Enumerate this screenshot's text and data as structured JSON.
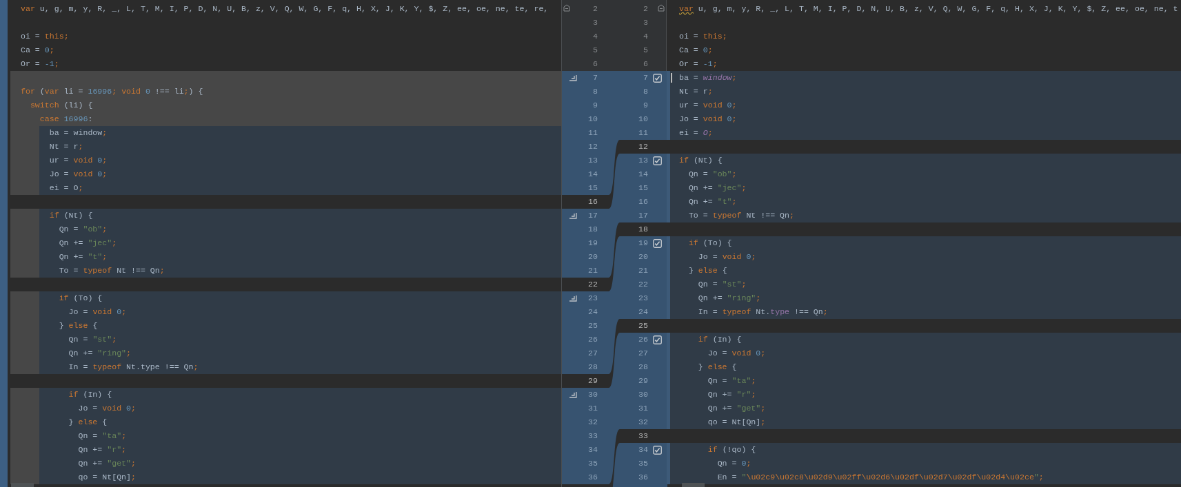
{
  "left_pane": {
    "lines": [
      {
        "num": "2",
        "kind": "context",
        "fold_marker": true,
        "tokens": [
          {
            "kind": "keyword",
            "text": "var"
          },
          {
            "kind": "plain",
            "text": " u, g, m, y, R, _, L, T, M, I, P, D, N, U, B, z, V, Q, W, G, F, q, H, X, J, K, Y, $, Z, ee, oe, ne, te, re,"
          }
        ]
      },
      {
        "num": "3",
        "kind": "context"
      },
      {
        "num": "4",
        "kind": "context",
        "tokens": [
          {
            "kind": "plain",
            "text": "oi = "
          },
          {
            "kind": "keyword",
            "text": "this;"
          }
        ]
      },
      {
        "num": "5",
        "kind": "context",
        "tokens": [
          {
            "kind": "plain",
            "text": "Ca = "
          },
          {
            "kind": "number",
            "text": "0"
          },
          {
            "kind": "keyword",
            "text": ";"
          }
        ]
      },
      {
        "num": "6",
        "kind": "context",
        "tokens": [
          {
            "kind": "plain",
            "text": "Or = "
          },
          {
            "kind": "number",
            "text": "-1"
          },
          {
            "kind": "keyword",
            "text": ";"
          }
        ]
      },
      {
        "num": "7",
        "kind": "removed",
        "apply_arrow": true
      },
      {
        "num": "8",
        "kind": "removed",
        "tokens": [
          {
            "kind": "keyword",
            "text": "for"
          },
          {
            "kind": "plain",
            "text": " ("
          },
          {
            "kind": "keyword",
            "text": "var"
          },
          {
            "kind": "plain",
            "text": " li = "
          },
          {
            "kind": "number",
            "text": "16996"
          },
          {
            "kind": "keyword",
            "text": "; void "
          },
          {
            "kind": "number",
            "text": "0"
          },
          {
            "kind": "plain",
            "text": " !== li"
          },
          {
            "kind": "keyword",
            "text": ";"
          },
          {
            "kind": "plain",
            "text": ") {"
          }
        ]
      },
      {
        "num": "9",
        "kind": "removed",
        "tokens": [
          {
            "kind": "keyword",
            "text": "  switch"
          },
          {
            "kind": "plain",
            "text": " (li) {"
          }
        ]
      },
      {
        "num": "10",
        "kind": "removed",
        "tokens": [
          {
            "kind": "keyword",
            "text": "    case "
          },
          {
            "kind": "number",
            "text": "16996"
          },
          {
            "kind": "plain",
            "text": ":"
          }
        ]
      },
      {
        "num": "11",
        "kind": "modified",
        "tokens": [
          {
            "kind": "plain",
            "text": "      ba = window"
          },
          {
            "kind": "keyword",
            "text": ";"
          }
        ]
      },
      {
        "num": "12",
        "kind": "modified",
        "tokens": [
          {
            "kind": "plain",
            "text": "      Nt = r"
          },
          {
            "kind": "keyword",
            "text": ";"
          }
        ]
      },
      {
        "num": "13",
        "kind": "modified",
        "tokens": [
          {
            "kind": "plain",
            "text": "      ur = "
          },
          {
            "kind": "keyword",
            "text": "void "
          },
          {
            "kind": "number",
            "text": "0"
          },
          {
            "kind": "keyword",
            "text": ";"
          }
        ]
      },
      {
        "num": "14",
        "kind": "modified",
        "tokens": [
          {
            "kind": "plain",
            "text": "      Jo = "
          },
          {
            "kind": "keyword",
            "text": "void "
          },
          {
            "kind": "number",
            "text": "0"
          },
          {
            "kind": "keyword",
            "text": ";"
          }
        ]
      },
      {
        "num": "15",
        "kind": "modified",
        "tokens": [
          {
            "kind": "plain",
            "text": "      ei = O"
          },
          {
            "kind": "keyword",
            "text": ";"
          }
        ]
      },
      {
        "num": "16",
        "kind": "gap"
      },
      {
        "num": "17",
        "kind": "modified",
        "apply_arrow": true,
        "tokens": [
          {
            "kind": "keyword",
            "text": "      if"
          },
          {
            "kind": "plain",
            "text": " (Nt) {"
          }
        ]
      },
      {
        "num": "18",
        "kind": "modified",
        "tokens": [
          {
            "kind": "plain",
            "text": "        Qn = "
          },
          {
            "kind": "string",
            "text": "\"ob\""
          },
          {
            "kind": "keyword",
            "text": ";"
          }
        ]
      },
      {
        "num": "19",
        "kind": "modified",
        "tokens": [
          {
            "kind": "plain",
            "text": "        Qn += "
          },
          {
            "kind": "string",
            "text": "\"jec\""
          },
          {
            "kind": "keyword",
            "text": ";"
          }
        ]
      },
      {
        "num": "20",
        "kind": "modified",
        "tokens": [
          {
            "kind": "plain",
            "text": "        Qn += "
          },
          {
            "kind": "string",
            "text": "\"t\""
          },
          {
            "kind": "keyword",
            "text": ";"
          }
        ]
      },
      {
        "num": "21",
        "kind": "modified",
        "tokens": [
          {
            "kind": "plain",
            "text": "        To = "
          },
          {
            "kind": "keyword",
            "text": "typeof"
          },
          {
            "kind": "plain",
            "text": " Nt !== Qn"
          },
          {
            "kind": "keyword",
            "text": ";"
          }
        ]
      },
      {
        "num": "22",
        "kind": "gap"
      },
      {
        "num": "23",
        "kind": "modified",
        "apply_arrow": true,
        "tokens": [
          {
            "kind": "keyword",
            "text": "        if"
          },
          {
            "kind": "plain",
            "text": " (To) {"
          }
        ]
      },
      {
        "num": "24",
        "kind": "modified",
        "tokens": [
          {
            "kind": "plain",
            "text": "          Jo = "
          },
          {
            "kind": "keyword",
            "text": "void "
          },
          {
            "kind": "number",
            "text": "0"
          },
          {
            "kind": "keyword",
            "text": ";"
          }
        ]
      },
      {
        "num": "25",
        "kind": "modified",
        "tokens": [
          {
            "kind": "plain",
            "text": "        } "
          },
          {
            "kind": "keyword",
            "text": "else"
          },
          {
            "kind": "plain",
            "text": " {"
          }
        ]
      },
      {
        "num": "26",
        "kind": "modified",
        "tokens": [
          {
            "kind": "plain",
            "text": "          Qn = "
          },
          {
            "kind": "string",
            "text": "\"st\""
          },
          {
            "kind": "keyword",
            "text": ";"
          }
        ]
      },
      {
        "num": "27",
        "kind": "modified",
        "tokens": [
          {
            "kind": "plain",
            "text": "          Qn += "
          },
          {
            "kind": "string",
            "text": "\"ring\""
          },
          {
            "kind": "keyword",
            "text": ";"
          }
        ]
      },
      {
        "num": "28",
        "kind": "modified",
        "tokens": [
          {
            "kind": "plain",
            "text": "          In = "
          },
          {
            "kind": "keyword",
            "text": "typeof"
          },
          {
            "kind": "plain",
            "text": " Nt.type !== Qn"
          },
          {
            "kind": "keyword",
            "text": ";"
          }
        ]
      },
      {
        "num": "29",
        "kind": "gap"
      },
      {
        "num": "30",
        "kind": "modified",
        "apply_arrow": true,
        "tokens": [
          {
            "kind": "keyword",
            "text": "          if"
          },
          {
            "kind": "plain",
            "text": " (In) {"
          }
        ]
      },
      {
        "num": "31",
        "kind": "modified",
        "tokens": [
          {
            "kind": "plain",
            "text": "            Jo = "
          },
          {
            "kind": "keyword",
            "text": "void "
          },
          {
            "kind": "number",
            "text": "0"
          },
          {
            "kind": "keyword",
            "text": ";"
          }
        ]
      },
      {
        "num": "32",
        "kind": "modified",
        "tokens": [
          {
            "kind": "plain",
            "text": "          } "
          },
          {
            "kind": "keyword",
            "text": "else"
          },
          {
            "kind": "plain",
            "text": " {"
          }
        ]
      },
      {
        "num": "33",
        "kind": "modified",
        "tokens": [
          {
            "kind": "plain",
            "text": "            Qn = "
          },
          {
            "kind": "string",
            "text": "\"ta\""
          },
          {
            "kind": "keyword",
            "text": ";"
          }
        ]
      },
      {
        "num": "34",
        "kind": "modified",
        "tokens": [
          {
            "kind": "plain",
            "text": "            Qn += "
          },
          {
            "kind": "string",
            "text": "\"r\""
          },
          {
            "kind": "keyword",
            "text": ";"
          }
        ]
      },
      {
        "num": "35",
        "kind": "modified",
        "tokens": [
          {
            "kind": "plain",
            "text": "            Qn += "
          },
          {
            "kind": "string",
            "text": "\"get\""
          },
          {
            "kind": "keyword",
            "text": ";"
          }
        ]
      },
      {
        "num": "36",
        "kind": "modified",
        "tokens": [
          {
            "kind": "plain",
            "text": "            qo = Nt[Qn]"
          },
          {
            "kind": "keyword",
            "text": ";"
          }
        ]
      }
    ]
  },
  "right_pane": {
    "lines": [
      {
        "num": "2",
        "kind": "context",
        "fold_marker": true,
        "tokens": [
          {
            "kind": "warning",
            "text": "var"
          },
          {
            "kind": "plain",
            "text": " u, g, m, y, R, _, L, T, M, I, P, D, N, U, B, z, V, Q, W, G, F, q, H, X, J, K, Y, $, Z, ee, oe, ne, t"
          }
        ]
      },
      {
        "num": "3",
        "kind": "context"
      },
      {
        "num": "4",
        "kind": "context",
        "tokens": [
          {
            "kind": "plain",
            "text": "oi = "
          },
          {
            "kind": "keyword",
            "text": "this;"
          }
        ]
      },
      {
        "num": "5",
        "kind": "context",
        "tokens": [
          {
            "kind": "plain",
            "text": "Ca = "
          },
          {
            "kind": "number",
            "text": "0"
          },
          {
            "kind": "keyword",
            "text": ";"
          }
        ]
      },
      {
        "num": "6",
        "kind": "context",
        "tokens": [
          {
            "kind": "plain",
            "text": "Or = "
          },
          {
            "kind": "number",
            "text": "-1"
          },
          {
            "kind": "keyword",
            "text": ";"
          }
        ]
      },
      {
        "num": "7",
        "kind": "modified",
        "caret": true,
        "chunk_checkbox": {
          "checked": true
        },
        "tokens": [
          {
            "kind": "plain",
            "text": "ba = "
          },
          {
            "kind": "global",
            "text": "window"
          },
          {
            "kind": "keyword",
            "text": ";"
          }
        ]
      },
      {
        "num": "8",
        "kind": "modified",
        "tokens": [
          {
            "kind": "plain",
            "text": "Nt = r"
          },
          {
            "kind": "keyword",
            "text": ";"
          }
        ]
      },
      {
        "num": "9",
        "kind": "modified",
        "tokens": [
          {
            "kind": "plain",
            "text": "ur = "
          },
          {
            "kind": "keyword",
            "text": "void "
          },
          {
            "kind": "number",
            "text": "0"
          },
          {
            "kind": "keyword",
            "text": ";"
          }
        ]
      },
      {
        "num": "10",
        "kind": "modified",
        "tokens": [
          {
            "kind": "plain",
            "text": "Jo = "
          },
          {
            "kind": "keyword",
            "text": "void "
          },
          {
            "kind": "number",
            "text": "0"
          },
          {
            "kind": "keyword",
            "text": ";"
          }
        ]
      },
      {
        "num": "11",
        "kind": "modified",
        "tokens": [
          {
            "kind": "plain",
            "text": "ei = "
          },
          {
            "kind": "global",
            "text": "O"
          },
          {
            "kind": "keyword",
            "text": ";"
          }
        ]
      },
      {
        "num": "12",
        "kind": "gap"
      },
      {
        "num": "13",
        "kind": "modified",
        "chunk_checkbox": {
          "checked": true
        },
        "tokens": [
          {
            "kind": "keyword",
            "text": "if"
          },
          {
            "kind": "plain",
            "text": " (Nt) {"
          }
        ]
      },
      {
        "num": "14",
        "kind": "modified",
        "tokens": [
          {
            "kind": "plain",
            "text": "  Qn = "
          },
          {
            "kind": "string",
            "text": "\"ob\""
          },
          {
            "kind": "keyword",
            "text": ";"
          }
        ]
      },
      {
        "num": "15",
        "kind": "modified",
        "tokens": [
          {
            "kind": "plain",
            "text": "  Qn += "
          },
          {
            "kind": "string",
            "text": "\"jec\""
          },
          {
            "kind": "keyword",
            "text": ";"
          }
        ]
      },
      {
        "num": "16",
        "kind": "modified",
        "tokens": [
          {
            "kind": "plain",
            "text": "  Qn += "
          },
          {
            "kind": "string",
            "text": "\"t\""
          },
          {
            "kind": "keyword",
            "text": ";"
          }
        ]
      },
      {
        "num": "17",
        "kind": "modified",
        "tokens": [
          {
            "kind": "plain",
            "text": "  To = "
          },
          {
            "kind": "keyword",
            "text": "typeof"
          },
          {
            "kind": "plain",
            "text": " Nt !== Qn"
          },
          {
            "kind": "keyword",
            "text": ";"
          }
        ]
      },
      {
        "num": "18",
        "kind": "gap"
      },
      {
        "num": "19",
        "kind": "modified",
        "chunk_checkbox": {
          "checked": true
        },
        "tokens": [
          {
            "kind": "keyword",
            "text": "  if"
          },
          {
            "kind": "plain",
            "text": " (To) {"
          }
        ]
      },
      {
        "num": "20",
        "kind": "modified",
        "tokens": [
          {
            "kind": "plain",
            "text": "    Jo = "
          },
          {
            "kind": "keyword",
            "text": "void "
          },
          {
            "kind": "number",
            "text": "0"
          },
          {
            "kind": "keyword",
            "text": ";"
          }
        ]
      },
      {
        "num": "21",
        "kind": "modified",
        "tokens": [
          {
            "kind": "plain",
            "text": "  } "
          },
          {
            "kind": "keyword",
            "text": "else"
          },
          {
            "kind": "plain",
            "text": " {"
          }
        ]
      },
      {
        "num": "22",
        "kind": "modified",
        "tokens": [
          {
            "kind": "plain",
            "text": "    Qn = "
          },
          {
            "kind": "string",
            "text": "\"st\""
          },
          {
            "kind": "keyword",
            "text": ";"
          }
        ]
      },
      {
        "num": "23",
        "kind": "modified",
        "tokens": [
          {
            "kind": "plain",
            "text": "    Qn += "
          },
          {
            "kind": "string",
            "text": "\"ring\""
          },
          {
            "kind": "keyword",
            "text": ";"
          }
        ]
      },
      {
        "num": "24",
        "kind": "modified",
        "tokens": [
          {
            "kind": "plain",
            "text": "    In = "
          },
          {
            "kind": "keyword",
            "text": "typeof"
          },
          {
            "kind": "plain",
            "text": " Nt."
          },
          {
            "kind": "property",
            "text": "type"
          },
          {
            "kind": "plain",
            "text": " !== Qn"
          },
          {
            "kind": "keyword",
            "text": ";"
          }
        ]
      },
      {
        "num": "25",
        "kind": "gap"
      },
      {
        "num": "26",
        "kind": "modified",
        "chunk_checkbox": {
          "checked": true
        },
        "tokens": [
          {
            "kind": "keyword",
            "text": "    if"
          },
          {
            "kind": "plain",
            "text": " (In) {"
          }
        ]
      },
      {
        "num": "27",
        "kind": "modified",
        "tokens": [
          {
            "kind": "plain",
            "text": "      Jo = "
          },
          {
            "kind": "keyword",
            "text": "void "
          },
          {
            "kind": "number",
            "text": "0"
          },
          {
            "kind": "keyword",
            "text": ";"
          }
        ]
      },
      {
        "num": "28",
        "kind": "modified",
        "tokens": [
          {
            "kind": "plain",
            "text": "    } "
          },
          {
            "kind": "keyword",
            "text": "else"
          },
          {
            "kind": "plain",
            "text": " {"
          }
        ]
      },
      {
        "num": "29",
        "kind": "modified",
        "tokens": [
          {
            "kind": "plain",
            "text": "      Qn = "
          },
          {
            "kind": "string",
            "text": "\"ta\""
          },
          {
            "kind": "keyword",
            "text": ";"
          }
        ]
      },
      {
        "num": "30",
        "kind": "modified",
        "tokens": [
          {
            "kind": "plain",
            "text": "      Qn += "
          },
          {
            "kind": "string",
            "text": "\"r\""
          },
          {
            "kind": "keyword",
            "text": ";"
          }
        ]
      },
      {
        "num": "31",
        "kind": "modified",
        "tokens": [
          {
            "kind": "plain",
            "text": "      Qn += "
          },
          {
            "kind": "string",
            "text": "\"get\""
          },
          {
            "kind": "keyword",
            "text": ";"
          }
        ]
      },
      {
        "num": "32",
        "kind": "modified",
        "tokens": [
          {
            "kind": "plain",
            "text": "      qo = Nt[Qn]"
          },
          {
            "kind": "keyword",
            "text": ";"
          }
        ]
      },
      {
        "num": "33",
        "kind": "gap"
      },
      {
        "num": "34",
        "kind": "modified",
        "chunk_checkbox": {
          "checked": true
        },
        "tokens": [
          {
            "kind": "keyword",
            "text": "      if"
          },
          {
            "kind": "plain",
            "text": " (!qo) {"
          }
        ]
      },
      {
        "num": "35",
        "kind": "modified",
        "tokens": [
          {
            "kind": "plain",
            "text": "        Qn = "
          },
          {
            "kind": "number",
            "text": "0"
          },
          {
            "kind": "keyword",
            "text": ";"
          }
        ]
      },
      {
        "num": "36",
        "kind": "modified",
        "tokens": [
          {
            "kind": "plain",
            "text": "        En = "
          },
          {
            "kind": "string",
            "text": "\""
          },
          {
            "kind": "escape",
            "text": "\\u02c9\\u02c8\\u02d9\\u02ff\\u02d6\\u02df\\u02d7\\u02df\\u02d4\\u02ce"
          },
          {
            "kind": "string",
            "text": "\""
          },
          {
            "kind": "keyword",
            "text": ";"
          }
        ]
      }
    ]
  }
}
